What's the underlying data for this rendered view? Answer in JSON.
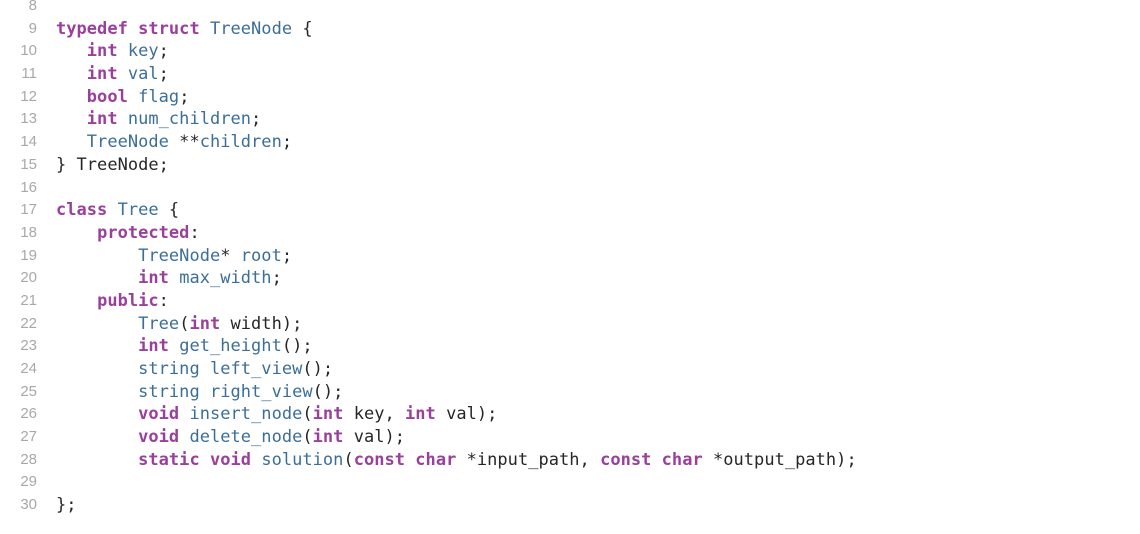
{
  "editor": {
    "language": "C++",
    "colors": {
      "keyword": "#9b3f9c",
      "type": "#3b6e98",
      "identifier": "#3b6e98",
      "plain": "#262626",
      "line_number": "#a8a8a8",
      "background": "#ffffff"
    },
    "lines": [
      {
        "n": "8",
        "tokens": []
      },
      {
        "n": "9",
        "tokens": [
          {
            "t": "typedef",
            "c": "kw"
          },
          {
            "t": " ",
            "c": "pl"
          },
          {
            "t": "struct",
            "c": "kw"
          },
          {
            "t": " ",
            "c": "pl"
          },
          {
            "t": "TreeNode",
            "c": "ty"
          },
          {
            "t": " {",
            "c": "pl"
          }
        ]
      },
      {
        "n": "10",
        "tokens": [
          {
            "t": "   ",
            "c": "pl"
          },
          {
            "t": "int",
            "c": "kw"
          },
          {
            "t": " ",
            "c": "pl"
          },
          {
            "t": "key",
            "c": "id"
          },
          {
            "t": ";",
            "c": "pl"
          }
        ]
      },
      {
        "n": "11",
        "tokens": [
          {
            "t": "   ",
            "c": "pl"
          },
          {
            "t": "int",
            "c": "kw"
          },
          {
            "t": " ",
            "c": "pl"
          },
          {
            "t": "val",
            "c": "id"
          },
          {
            "t": ";",
            "c": "pl"
          }
        ]
      },
      {
        "n": "12",
        "tokens": [
          {
            "t": "   ",
            "c": "pl"
          },
          {
            "t": "bool",
            "c": "kw"
          },
          {
            "t": " ",
            "c": "pl"
          },
          {
            "t": "flag",
            "c": "id"
          },
          {
            "t": ";",
            "c": "pl"
          }
        ]
      },
      {
        "n": "13",
        "tokens": [
          {
            "t": "   ",
            "c": "pl"
          },
          {
            "t": "int",
            "c": "kw"
          },
          {
            "t": " ",
            "c": "pl"
          },
          {
            "t": "num_children",
            "c": "id"
          },
          {
            "t": ";",
            "c": "pl"
          }
        ]
      },
      {
        "n": "14",
        "tokens": [
          {
            "t": "   ",
            "c": "pl"
          },
          {
            "t": "TreeNode",
            "c": "ty"
          },
          {
            "t": " **",
            "c": "pl"
          },
          {
            "t": "children",
            "c": "id"
          },
          {
            "t": ";",
            "c": "pl"
          }
        ]
      },
      {
        "n": "15",
        "tokens": [
          {
            "t": "} TreeNode;",
            "c": "pl"
          }
        ]
      },
      {
        "n": "16",
        "tokens": []
      },
      {
        "n": "17",
        "tokens": [
          {
            "t": "class",
            "c": "kw"
          },
          {
            "t": " ",
            "c": "pl"
          },
          {
            "t": "Tree",
            "c": "ty"
          },
          {
            "t": " {",
            "c": "pl"
          }
        ]
      },
      {
        "n": "18",
        "tokens": [
          {
            "t": "    ",
            "c": "pl"
          },
          {
            "t": "protected",
            "c": "kw"
          },
          {
            "t": ":",
            "c": "pl"
          }
        ]
      },
      {
        "n": "19",
        "tokens": [
          {
            "t": "        ",
            "c": "pl"
          },
          {
            "t": "TreeNode",
            "c": "ty"
          },
          {
            "t": "* ",
            "c": "pl"
          },
          {
            "t": "root",
            "c": "id"
          },
          {
            "t": ";",
            "c": "pl"
          }
        ]
      },
      {
        "n": "20",
        "tokens": [
          {
            "t": "        ",
            "c": "pl"
          },
          {
            "t": "int",
            "c": "kw"
          },
          {
            "t": " ",
            "c": "pl"
          },
          {
            "t": "max_width",
            "c": "id"
          },
          {
            "t": ";",
            "c": "pl"
          }
        ]
      },
      {
        "n": "21",
        "tokens": [
          {
            "t": "    ",
            "c": "pl"
          },
          {
            "t": "public",
            "c": "kw"
          },
          {
            "t": ":",
            "c": "pl"
          }
        ]
      },
      {
        "n": "22",
        "tokens": [
          {
            "t": "        ",
            "c": "pl"
          },
          {
            "t": "Tree",
            "c": "id"
          },
          {
            "t": "(",
            "c": "pl"
          },
          {
            "t": "int",
            "c": "kw"
          },
          {
            "t": " width);",
            "c": "pl"
          }
        ]
      },
      {
        "n": "23",
        "tokens": [
          {
            "t": "        ",
            "c": "pl"
          },
          {
            "t": "int",
            "c": "kw"
          },
          {
            "t": " ",
            "c": "pl"
          },
          {
            "t": "get_height",
            "c": "id"
          },
          {
            "t": "();",
            "c": "pl"
          }
        ]
      },
      {
        "n": "24",
        "tokens": [
          {
            "t": "        ",
            "c": "pl"
          },
          {
            "t": "string",
            "c": "ty"
          },
          {
            "t": " ",
            "c": "pl"
          },
          {
            "t": "left_view",
            "c": "id"
          },
          {
            "t": "();",
            "c": "pl"
          }
        ]
      },
      {
        "n": "25",
        "tokens": [
          {
            "t": "        ",
            "c": "pl"
          },
          {
            "t": "string",
            "c": "ty"
          },
          {
            "t": " ",
            "c": "pl"
          },
          {
            "t": "right_view",
            "c": "id"
          },
          {
            "t": "();",
            "c": "pl"
          }
        ]
      },
      {
        "n": "26",
        "tokens": [
          {
            "t": "        ",
            "c": "pl"
          },
          {
            "t": "void",
            "c": "kw"
          },
          {
            "t": " ",
            "c": "pl"
          },
          {
            "t": "insert_node",
            "c": "id"
          },
          {
            "t": "(",
            "c": "pl"
          },
          {
            "t": "int",
            "c": "kw"
          },
          {
            "t": " key, ",
            "c": "pl"
          },
          {
            "t": "int",
            "c": "kw"
          },
          {
            "t": " val);",
            "c": "pl"
          }
        ]
      },
      {
        "n": "27",
        "tokens": [
          {
            "t": "        ",
            "c": "pl"
          },
          {
            "t": "void",
            "c": "kw"
          },
          {
            "t": " ",
            "c": "pl"
          },
          {
            "t": "delete_node",
            "c": "id"
          },
          {
            "t": "(",
            "c": "pl"
          },
          {
            "t": "int",
            "c": "kw"
          },
          {
            "t": " val);",
            "c": "pl"
          }
        ]
      },
      {
        "n": "28",
        "tokens": [
          {
            "t": "        ",
            "c": "pl"
          },
          {
            "t": "static",
            "c": "kw"
          },
          {
            "t": " ",
            "c": "pl"
          },
          {
            "t": "void",
            "c": "kw"
          },
          {
            "t": " ",
            "c": "pl"
          },
          {
            "t": "solution",
            "c": "id"
          },
          {
            "t": "(",
            "c": "pl"
          },
          {
            "t": "const",
            "c": "kw"
          },
          {
            "t": " ",
            "c": "pl"
          },
          {
            "t": "char",
            "c": "kw"
          },
          {
            "t": " *input_path, ",
            "c": "pl"
          },
          {
            "t": "const",
            "c": "kw"
          },
          {
            "t": " ",
            "c": "pl"
          },
          {
            "t": "char",
            "c": "kw"
          },
          {
            "t": " *output_path);",
            "c": "pl"
          }
        ]
      },
      {
        "n": "29",
        "tokens": []
      },
      {
        "n": "30",
        "tokens": [
          {
            "t": "};",
            "c": "pl"
          }
        ]
      }
    ]
  }
}
